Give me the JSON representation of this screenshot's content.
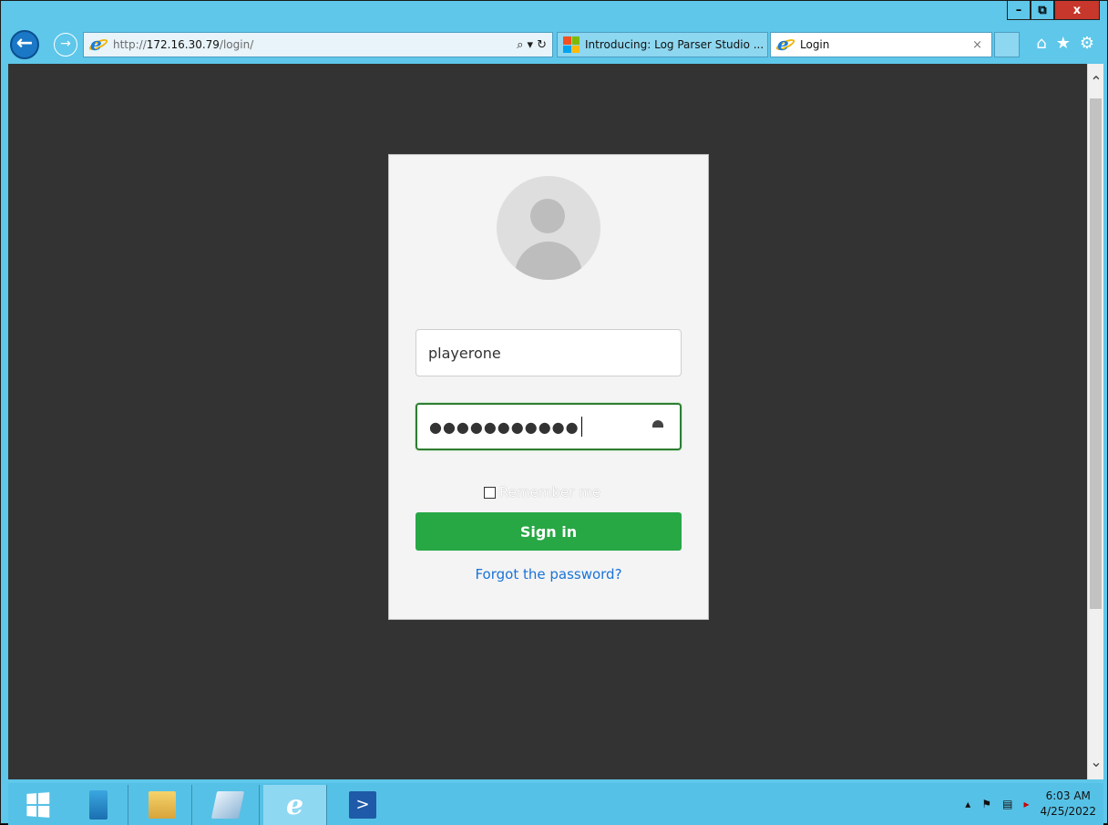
{
  "browser": {
    "url_prefix": "http://",
    "url_host": "172.16.30.79",
    "url_path": "/login/",
    "search_icon": "⌕ ▾",
    "refresh_icon": "↻",
    "tabs": [
      {
        "title": "Introducing: Log Parser Studio ...",
        "icon": "microsoft-logo"
      },
      {
        "title": "Login",
        "icon": "ie-logo",
        "close": "×"
      }
    ],
    "window_controls": {
      "minimize": "–",
      "restore": "⧉",
      "close": "x"
    },
    "tools": {
      "home": "⌂",
      "favorites": "★",
      "settings": "⚙"
    }
  },
  "login": {
    "username": "playerone",
    "password_mask": "●●●●●●●●●●●",
    "remember_label": "Remember me",
    "signin_label": "Sign in",
    "forgot_label": "Forgot the password?"
  },
  "taskbar": {
    "time": "6:03 AM",
    "date": "4/25/2022",
    "apps": [
      "server-manager-icon",
      "file-explorer-icon",
      "notepad-icon",
      "internet-explorer-icon",
      "powershell-icon"
    ]
  },
  "colors": {
    "accent_green": "#28a745",
    "link_blue": "#1a73d8",
    "page_bg": "#333333",
    "chrome_blue": "#5ec7ea"
  }
}
